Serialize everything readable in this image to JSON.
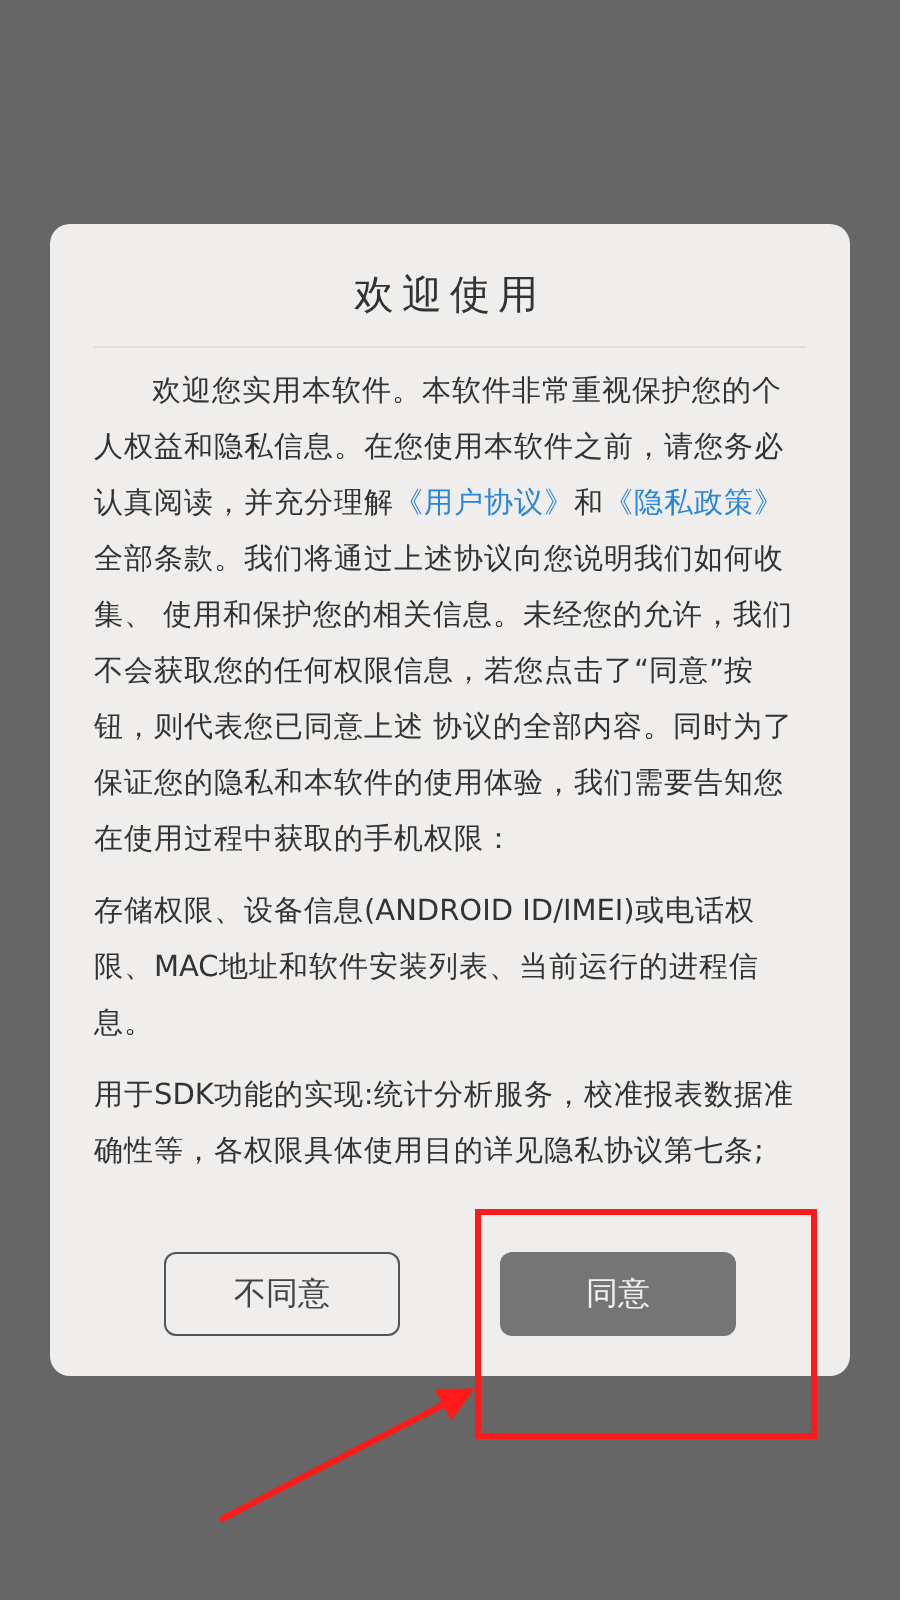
{
  "dialog": {
    "title": "欢迎使用",
    "paragraphs": [
      {
        "indent": true,
        "segments": [
          {
            "kind": "text",
            "text": "欢迎您实用本软件。本软件非常重视保护您的个人权益和隐私信息。在您使用本软件之前，请您务必认真阅读，并充分理解"
          },
          {
            "kind": "link",
            "text": "《用户协议》"
          },
          {
            "kind": "text",
            "text": "和"
          },
          {
            "kind": "link",
            "text": "《隐私政策》"
          },
          {
            "kind": "text",
            "text": "全部条款。我们将通过上述协议向您说明我们如何收集、 使用和保护您的相关信息。未经您的允许，我们不会获取您的任何权限信息，若您点击了“同意”按钮，则代表您已同意上述 协议的全部内容。同时为了保证您的隐私和本软件的使用体验，我们需要告知您在使用过程中获取的手机权限："
          }
        ]
      },
      {
        "indent": false,
        "segments": [
          {
            "kind": "text",
            "text": "存储权限、设备信息(ANDROID ID/IMEI)或电话权限、MAC地址和软件安装列表、当前运行的进程信息。"
          }
        ]
      },
      {
        "indent": false,
        "segments": [
          {
            "kind": "text",
            "text": "用于SDK功能的实现:统计分析服务，校准报表数据准确性等，各权限具体使用目的详见隐私协议第七条;"
          }
        ]
      }
    ],
    "buttons": [
      {
        "label": "不同意",
        "kind": "outline"
      },
      {
        "label": "同意",
        "kind": "primary"
      }
    ]
  }
}
